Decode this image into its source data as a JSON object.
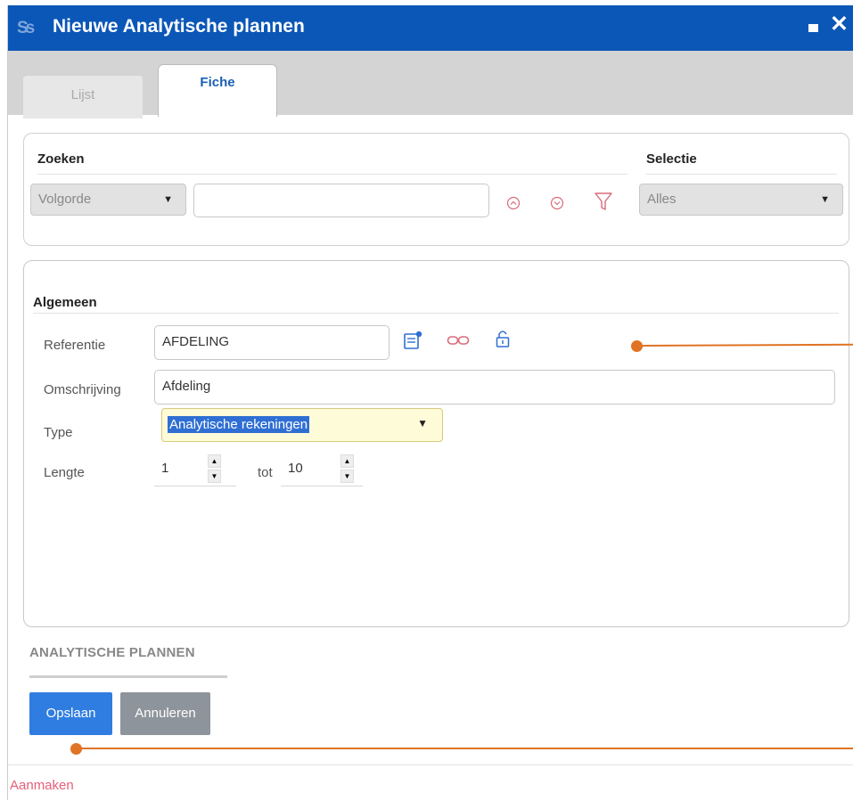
{
  "window": {
    "title": "Nieuwe Analytische plannen",
    "logo": "Ss"
  },
  "tabs": [
    {
      "label": "Lijst"
    },
    {
      "label": "Fiche"
    }
  ],
  "search": {
    "heading": "Zoeken",
    "order_select": "Volgorde",
    "query_value": "",
    "selection_heading": "Selectie",
    "selection_value": "Alles"
  },
  "general": {
    "heading": "Algemeen",
    "reference_label": "Referentie",
    "reference_value": "AFDELING",
    "description_label": "Omschrijving",
    "description_value": "Afdeling",
    "type_label": "Type",
    "type_value": "Analytische rekeningen",
    "length_label": "Lengte",
    "length_from": "1",
    "length_to_label": "tot",
    "length_to": "10"
  },
  "footer": {
    "section_title": "ANALYTISCHE PLANNEN",
    "save_label": "Opslaan",
    "cancel_label": "Annuleren"
  },
  "status": {
    "text": "Aanmaken"
  },
  "colors": {
    "titlebar": "#0b57b7",
    "accent": "#2f7de1",
    "callout": "#e07324",
    "status_text": "#e55e7a"
  },
  "icons": [
    "restore-icon",
    "close-icon",
    "caret-down-icon",
    "move-up-icon",
    "move-down-icon",
    "filter-icon",
    "new-record-icon",
    "link-icon",
    "lock-icon",
    "spin-up-icon",
    "spin-down-icon"
  ]
}
